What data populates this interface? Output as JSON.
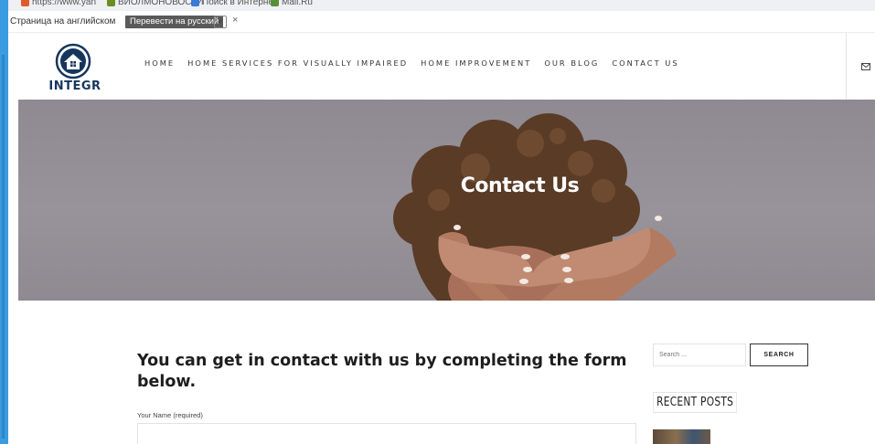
{
  "browser": {
    "bookmarks": [
      {
        "label": "https://www.yan",
        "color": "#e05a2b"
      },
      {
        "label": "ВИОЛМОНОВОСТИ",
        "color": "#6b8e23"
      },
      {
        "label": "Поиск в Интерне",
        "color": "#3a7bd5"
      },
      {
        "label": "Mail.Ru",
        "color": "#5a8f3a"
      }
    ],
    "translate_bar": {
      "page_language": "Страница на английском",
      "translate_button": "Перевести на русский",
      "dropdown_glyph": "✓",
      "close_glyph": "×"
    }
  },
  "site": {
    "logo_text": "INTEGR",
    "brand_color": "#17365d",
    "nav": [
      "HOME",
      "HOME SERVICES FOR VISUALLY IMPAIRED",
      "HOME IMPROVEMENT",
      "OUR BLOG",
      "CONTACT US"
    ],
    "header_icon": "mail-icon"
  },
  "hero": {
    "title": "Contact Us"
  },
  "form": {
    "heading": "You can get in contact with us by completing the form below.",
    "name_label": "Your Name (required)",
    "name_value": ""
  },
  "sidebar": {
    "search_placeholder": "Search ...",
    "search_button": "SEARCH",
    "recent_posts_title": "RECENT POSTS"
  }
}
